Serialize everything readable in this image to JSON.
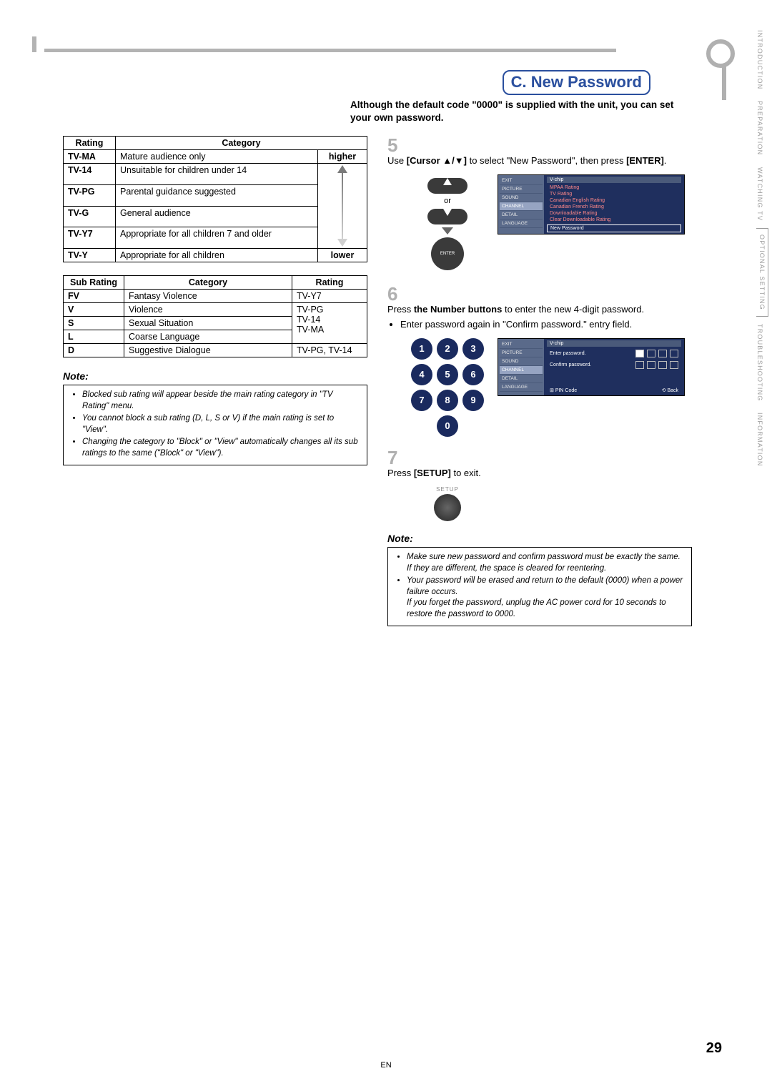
{
  "sideTabs": [
    "INTRODUCTION",
    "PREPARATION",
    "WATCHING TV",
    "OPTIONAL SETTING",
    "TROUBLESHOOTING",
    "INFORMATION"
  ],
  "sectionPrefix": "C.",
  "sectionTitle": "New Password",
  "intro": "Although the default code \"0000\" is supplied with the unit, you can set your own password.",
  "ratingHead": {
    "c1": "Rating",
    "c2": "Category"
  },
  "arrowTop": "higher",
  "arrowBot": "lower",
  "ratings": [
    {
      "r": "TV-MA",
      "c": "Mature audience only"
    },
    {
      "r": "TV-14",
      "c": "Unsuitable for children under 14"
    },
    {
      "r": "TV-PG",
      "c": "Parental guidance suggested"
    },
    {
      "r": "TV-G",
      "c": "General audience"
    },
    {
      "r": "TV-Y7",
      "c": "Appropriate for all children 7 and older"
    },
    {
      "r": "TV-Y",
      "c": "Appropriate for all children"
    }
  ],
  "subHead": {
    "c1": "Sub Rating",
    "c2": "Category",
    "c3": "Rating"
  },
  "subs": [
    {
      "r": "FV",
      "c": "Fantasy Violence",
      "g": "TV-Y7"
    },
    {
      "r": "V",
      "c": "Violence",
      "g": "TV-PG"
    },
    {
      "r": "S",
      "c": "Sexual Situation",
      "g": "TV-14"
    },
    {
      "r": "L",
      "c": "Coarse Language",
      "g": "TV-MA"
    },
    {
      "r": "D",
      "c": "Suggestive Dialogue",
      "g2": "TV-PG, TV-14"
    }
  ],
  "noteLabel": "Note:",
  "notesA": [
    "Blocked sub rating will appear beside the main rating category in \"TV Rating\" menu.",
    "You cannot block a sub rating (D, L, S or V) if the main rating is set to \"View\".",
    "Changing the category to \"Block\" or \"View\" automatically changes all its sub ratings to the same (\"Block\" or \"View\")."
  ],
  "step5": {
    "n": "5",
    "a": "Use ",
    "b": "[Cursor ▲/▼]",
    "c": " to select \"New Password\", then press ",
    "d": "[ENTER]",
    "e": "."
  },
  "step6": {
    "n": "6",
    "a": "Press ",
    "b": "the Number buttons",
    "c": " to enter the new 4-digit password.",
    "d": "Enter password again in \"Confirm password.\" entry field."
  },
  "step7": {
    "n": "7",
    "a": "Press ",
    "b": "[SETUP]",
    "c": " to exit."
  },
  "orLabel": "or",
  "enterLabel": "ENTER",
  "setupLabel": "SETUP",
  "tvSide": [
    "EXIT",
    "PICTURE",
    "SOUND",
    "CHANNEL",
    "DETAIL",
    "LANGUAGE"
  ],
  "tvA": {
    "hdr": "V-chip",
    "rows": [
      "MPAA Rating",
      "TV Rating",
      "Canadian English Rating",
      "Canadian French Rating",
      "Downloadable Rating",
      "Clear Downloadable Rating"
    ],
    "box": "New Password"
  },
  "tvB": {
    "hdr": "V-chip",
    "l1": "Enter password.",
    "l2": "Confirm password.",
    "pin": "PIN Code",
    "back": "Back"
  },
  "notesB": [
    "Make sure new password and confirm password must be exactly the same. If they are different, the space is cleared for reentering.",
    "Your password will be erased and return to the default (0000) when a power failure occurs.\nIf you forget the password, unplug the AC power cord for 10 seconds to restore the password to 0000."
  ],
  "pageNum": "29",
  "lang": "EN"
}
